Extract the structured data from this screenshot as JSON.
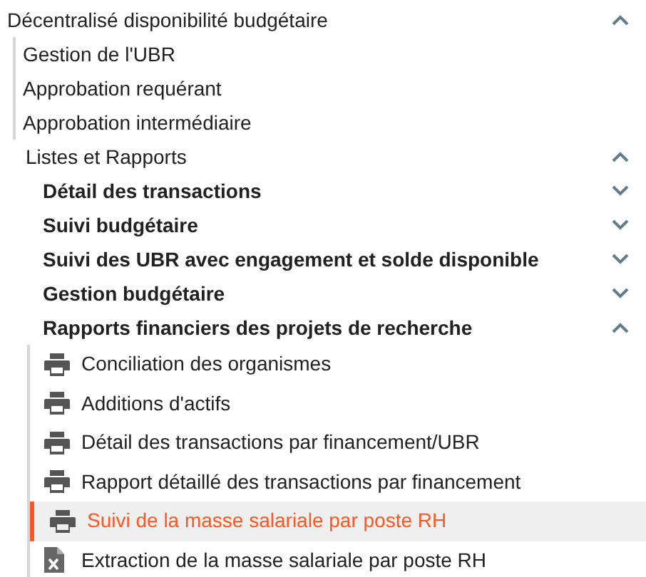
{
  "menu": {
    "label": "Décentralisé disponibilité budgétaire",
    "expanded": true,
    "children": [
      {
        "kind": "link",
        "label": "Gestion de l'UBR"
      },
      {
        "kind": "link",
        "label": "Approbation requérant"
      },
      {
        "kind": "link",
        "label": "Approbation intermédiaire"
      },
      {
        "kind": "group",
        "label": "Listes et Rapports",
        "expanded": true,
        "children": [
          {
            "label": "Détail des transactions",
            "expanded": false
          },
          {
            "label": "Suivi budgétaire",
            "expanded": false
          },
          {
            "label": "Suivi des UBR avec engagement et solde disponible",
            "expanded": false
          },
          {
            "label": "Gestion budgétaire",
            "expanded": false
          },
          {
            "label": "Rapports financiers des projets de recherche",
            "expanded": true,
            "children": [
              {
                "kind": "print",
                "label": "Conciliation des organismes",
                "selected": false
              },
              {
                "kind": "print",
                "label": "Additions d'actifs",
                "selected": false
              },
              {
                "kind": "print",
                "label": "Détail des transactions par financement/UBR",
                "selected": false
              },
              {
                "kind": "print",
                "label": "Rapport détaillé des transactions par financement",
                "selected": false
              },
              {
                "kind": "print",
                "label": "Suivi de la masse salariale par poste RH",
                "selected": true
              },
              {
                "kind": "spreadsheet",
                "label": "Extraction de la masse salariale par poste RH",
                "selected": false
              }
            ]
          }
        ]
      }
    ]
  }
}
